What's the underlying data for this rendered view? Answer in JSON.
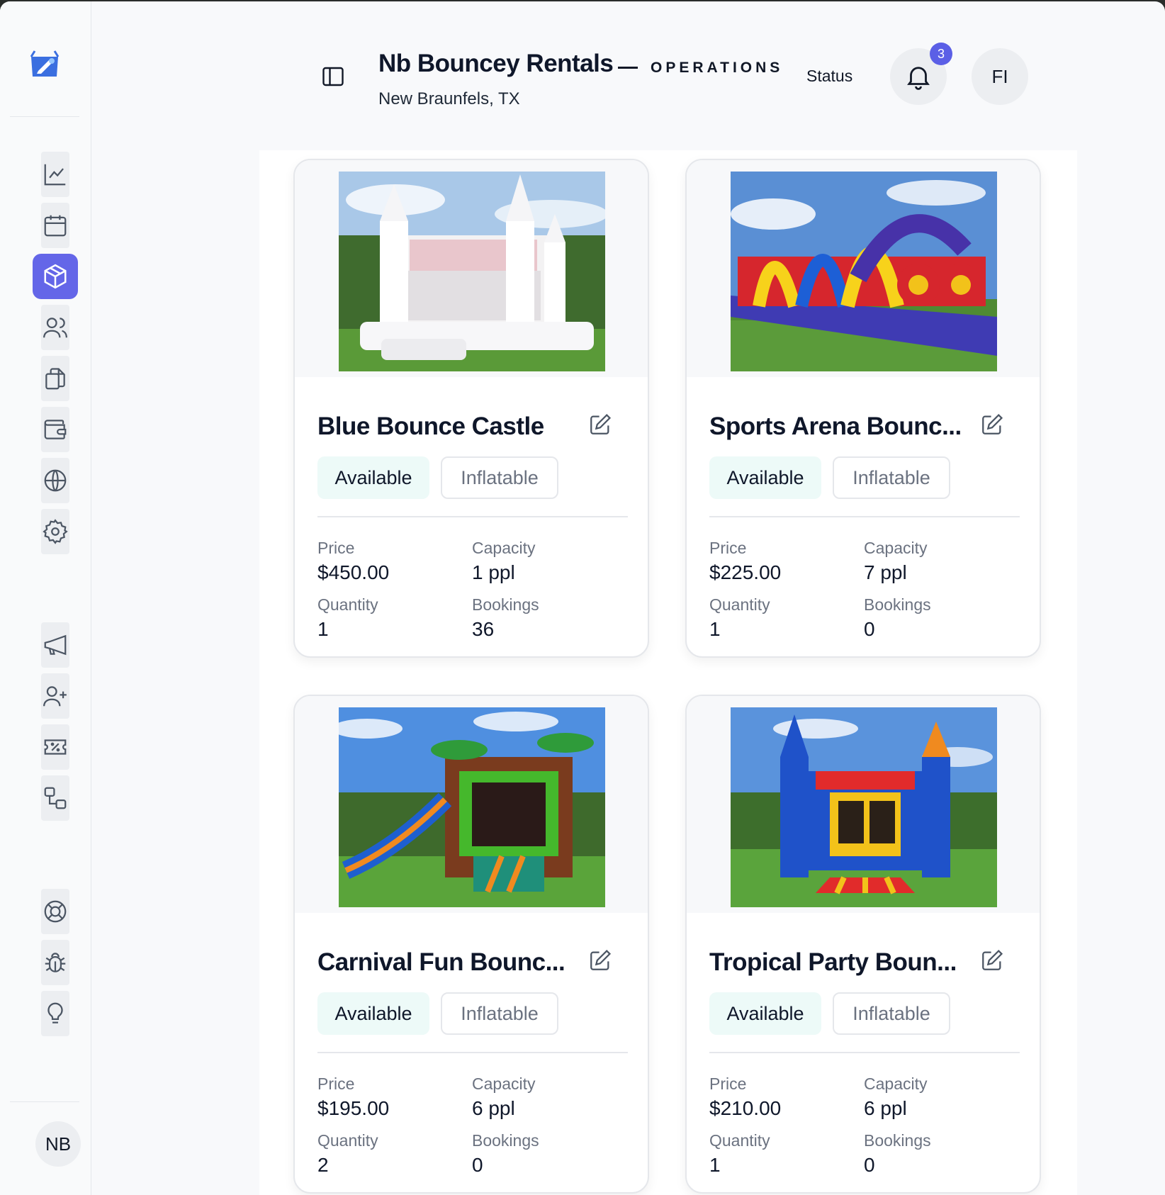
{
  "header": {
    "brand": "Nb Bouncey Rentals",
    "section": "OPERATIONS",
    "location": "New Braunfels, TX",
    "status_label": "Status",
    "notification_count": "3",
    "user_initials": "FI"
  },
  "sidebar": {
    "items": [
      {
        "icon": "analytics-icon"
      },
      {
        "icon": "calendar-icon"
      },
      {
        "icon": "box-icon",
        "active": true
      },
      {
        "icon": "users-icon"
      },
      {
        "icon": "documents-icon"
      },
      {
        "icon": "wallet-icon"
      },
      {
        "icon": "globe-icon"
      },
      {
        "icon": "gear-icon"
      },
      {
        "icon": "megaphone-icon"
      },
      {
        "icon": "add-user-icon"
      },
      {
        "icon": "ticket-icon"
      },
      {
        "icon": "workflow-icon"
      },
      {
        "icon": "lifebuoy-icon"
      },
      {
        "icon": "bug-icon"
      },
      {
        "icon": "lightbulb-icon"
      }
    ],
    "avatar_initials": "NB"
  },
  "accent_color": "#6466e8",
  "products": [
    {
      "title": "Blue Bounce Castle",
      "status": "Available",
      "type": "Inflatable",
      "price_label": "Price",
      "price": "$450.00",
      "capacity_label": "Capacity",
      "capacity": "1 ppl",
      "quantity_label": "Quantity",
      "quantity": "1",
      "bookings_label": "Bookings",
      "bookings": "36"
    },
    {
      "title": "Sports Arena Bounc...",
      "status": "Available",
      "type": "Inflatable",
      "price_label": "Price",
      "price": "$225.00",
      "capacity_label": "Capacity",
      "capacity": "7 ppl",
      "quantity_label": "Quantity",
      "quantity": "1",
      "bookings_label": "Bookings",
      "bookings": "0"
    },
    {
      "title": "Carnival Fun Bounc...",
      "status": "Available",
      "type": "Inflatable",
      "price_label": "Price",
      "price": "$195.00",
      "capacity_label": "Capacity",
      "capacity": "6 ppl",
      "quantity_label": "Quantity",
      "quantity": "2",
      "bookings_label": "Bookings",
      "bookings": "0"
    },
    {
      "title": "Tropical Party Boun...",
      "status": "Available",
      "type": "Inflatable",
      "price_label": "Price",
      "price": "$210.00",
      "capacity_label": "Capacity",
      "capacity": "6 ppl",
      "quantity_label": "Quantity",
      "quantity": "1",
      "bookings_label": "Bookings",
      "bookings": "0"
    }
  ]
}
